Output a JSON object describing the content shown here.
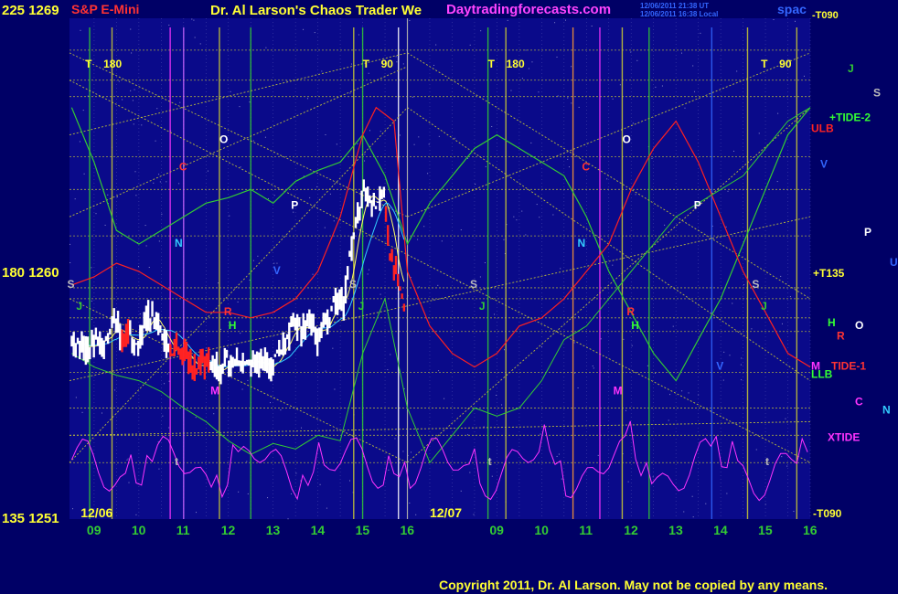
{
  "header": {
    "left_price": "225 1269",
    "symbol": "S&P E-Mini",
    "title": "Dr. Al Larson's Chaos Trader We",
    "site": "Daytradingforecasts.com",
    "timestamp_1": "12/06/2011 21:38 UT",
    "timestamp_2": "12/06/2011 16:38 Local",
    "top_right": "spac",
    "top_right_2": "-T090"
  },
  "footer": {
    "copyright": "Copyright 2011, Dr. Al Larson. May not be copied by any means."
  },
  "colors": {
    "background": "#000066",
    "panel": "#0a0a8a",
    "grid_yellow": "#cccc33",
    "price_white": "#ffffff",
    "price_red": "#ff2222",
    "ma_yellow": "#ffff66",
    "ma_cyan": "#33ccff",
    "red_line": "#ff2020",
    "green_line": "#33cc33",
    "magenta_line": "#ff33ff",
    "title_yellow": "#ffff33",
    "site_magenta": "#ff44ff"
  },
  "chart_data": {
    "type": "line",
    "title": "S&P E-Mini",
    "xlabel": "",
    "ylabel": "",
    "ylim": [
      1251,
      1269
    ],
    "grid": true,
    "y_axis_labels": [
      {
        "value": 1269,
        "text": "225 1269"
      },
      {
        "value": 1260,
        "text": "180 1260"
      },
      {
        "value": 1251,
        "text": "135 1251"
      }
    ],
    "dates": [
      "12/06",
      "12/07"
    ],
    "x_ticks": [
      "09",
      "10",
      "11",
      "12",
      "13",
      "14",
      "15",
      "16",
      "09",
      "10",
      "11",
      "12",
      "13",
      "14",
      "15",
      "16"
    ],
    "phase_markers": [
      {
        "text": "T",
        "value": "180",
        "hour": 8.8
      },
      {
        "text": "T",
        "value": "90",
        "hour": 15.0
      },
      {
        "text": "T",
        "value": "180",
        "hour": 17.8
      },
      {
        "text": "T",
        "value": "90",
        "hour": 23.9
      }
    ],
    "planet_markers": [
      {
        "text": "O",
        "hour": 11.8,
        "price": 1264.7,
        "color": "#ffffff"
      },
      {
        "text": "C",
        "hour": 10.9,
        "price": 1263.7,
        "color": "#ff3333"
      },
      {
        "text": "N",
        "hour": 10.8,
        "price": 1260.9,
        "color": "#33ccff"
      },
      {
        "text": "P",
        "hour": 13.4,
        "price": 1262.3,
        "color": "#ffffff"
      },
      {
        "text": "V",
        "hour": 13.0,
        "price": 1259.9,
        "color": "#3366ff"
      },
      {
        "text": "S",
        "hour": 8.4,
        "price": 1259.4,
        "color": "#bbbbbb"
      },
      {
        "text": "J",
        "hour": 8.6,
        "price": 1258.6,
        "color": "#33cc33"
      },
      {
        "text": "R",
        "hour": 11.9,
        "price": 1258.4,
        "color": "#ff3333"
      },
      {
        "text": "H",
        "hour": 12.0,
        "price": 1257.9,
        "color": "#33ff33"
      },
      {
        "text": "M",
        "hour": 11.6,
        "price": 1255.5,
        "color": "#ff33ff"
      },
      {
        "text": "S",
        "hour": 14.7,
        "price": 1259.4,
        "color": "#bbbbbb"
      },
      {
        "text": "J",
        "hour": 14.9,
        "price": 1258.6,
        "color": "#33cc33"
      },
      {
        "text": "t",
        "hour": 10.8,
        "price": 1252.9,
        "color": "#bbbbbb"
      },
      {
        "text": "O",
        "hour": 20.8,
        "price": 1264.7,
        "color": "#ffffff"
      },
      {
        "text": "C",
        "hour": 19.9,
        "price": 1263.7,
        "color": "#ff3333"
      },
      {
        "text": "N",
        "hour": 19.8,
        "price": 1260.9,
        "color": "#33ccff"
      },
      {
        "text": "P",
        "hour": 22.4,
        "price": 1262.3,
        "color": "#ffffff"
      },
      {
        "text": "S",
        "hour": 17.4,
        "price": 1259.4,
        "color": "#bbbbbb"
      },
      {
        "text": "J",
        "hour": 17.6,
        "price": 1258.6,
        "color": "#33cc33"
      },
      {
        "text": "R",
        "hour": 20.9,
        "price": 1258.4,
        "color": "#ff3333"
      },
      {
        "text": "H",
        "hour": 21.0,
        "price": 1257.9,
        "color": "#33ff33"
      },
      {
        "text": "M",
        "hour": 20.6,
        "price": 1255.5,
        "color": "#ff33ff"
      },
      {
        "text": "S",
        "hour": 23.7,
        "price": 1259.4,
        "color": "#bbbbbb"
      },
      {
        "text": "J",
        "hour": 23.9,
        "price": 1258.6,
        "color": "#33cc33"
      },
      {
        "text": "V",
        "hour": 22.9,
        "price": 1256.4,
        "color": "#3366ff"
      },
      {
        "text": "t",
        "hour": 17.8,
        "price": 1252.9,
        "color": "#bbbbbb"
      },
      {
        "text": "t",
        "hour": 24.0,
        "price": 1252.9,
        "color": "#bbbbbb"
      }
    ],
    "right_labels": [
      {
        "text": "J",
        "price": 1267.3,
        "color": "#33cc33",
        "offset": 40
      },
      {
        "text": "S",
        "price": 1266.4,
        "color": "#bbbbbb",
        "offset": 68
      },
      {
        "text": "+TIDE-2",
        "price": 1265.5,
        "color": "#33ff33",
        "offset": 20
      },
      {
        "text": "ULB",
        "price": 1265.1,
        "color": "#ff2222",
        "offset": 0
      },
      {
        "text": "V",
        "price": 1263.8,
        "color": "#3366ff",
        "offset": 10
      },
      {
        "text": "P",
        "price": 1261.3,
        "color": "#ffffff",
        "offset": 58
      },
      {
        "text": "U",
        "price": 1260.2,
        "color": "#3366ff",
        "offset": 86
      },
      {
        "text": "+T135",
        "price": 1259.8,
        "color": "#ffff33",
        "offset": 2
      },
      {
        "text": "H",
        "price": 1258.0,
        "color": "#33ff33",
        "offset": 18
      },
      {
        "text": "O",
        "price": 1257.9,
        "color": "#ffffff",
        "offset": 48
      },
      {
        "text": "R",
        "price": 1257.5,
        "color": "#ff3333",
        "offset": 28
      },
      {
        "text": "M",
        "price": 1256.4,
        "color": "#ff33ff",
        "offset": 0
      },
      {
        "text": "TIDE-1",
        "price": 1256.4,
        "color": "#ff3333",
        "offset": 22
      },
      {
        "text": "LLB",
        "price": 1256.1,
        "color": "#33ff33",
        "offset": 0
      },
      {
        "text": "C",
        "price": 1255.1,
        "color": "#ff33ff",
        "offset": 48
      },
      {
        "text": "N",
        "price": 1254.8,
        "color": "#33ccff",
        "offset": 78
      },
      {
        "text": "XTIDE",
        "price": 1253.8,
        "color": "#ff33ff",
        "offset": 18
      },
      {
        "text": "-T090",
        "price": 1251.0,
        "color": "#ffff33",
        "offset": 2
      }
    ]
  }
}
